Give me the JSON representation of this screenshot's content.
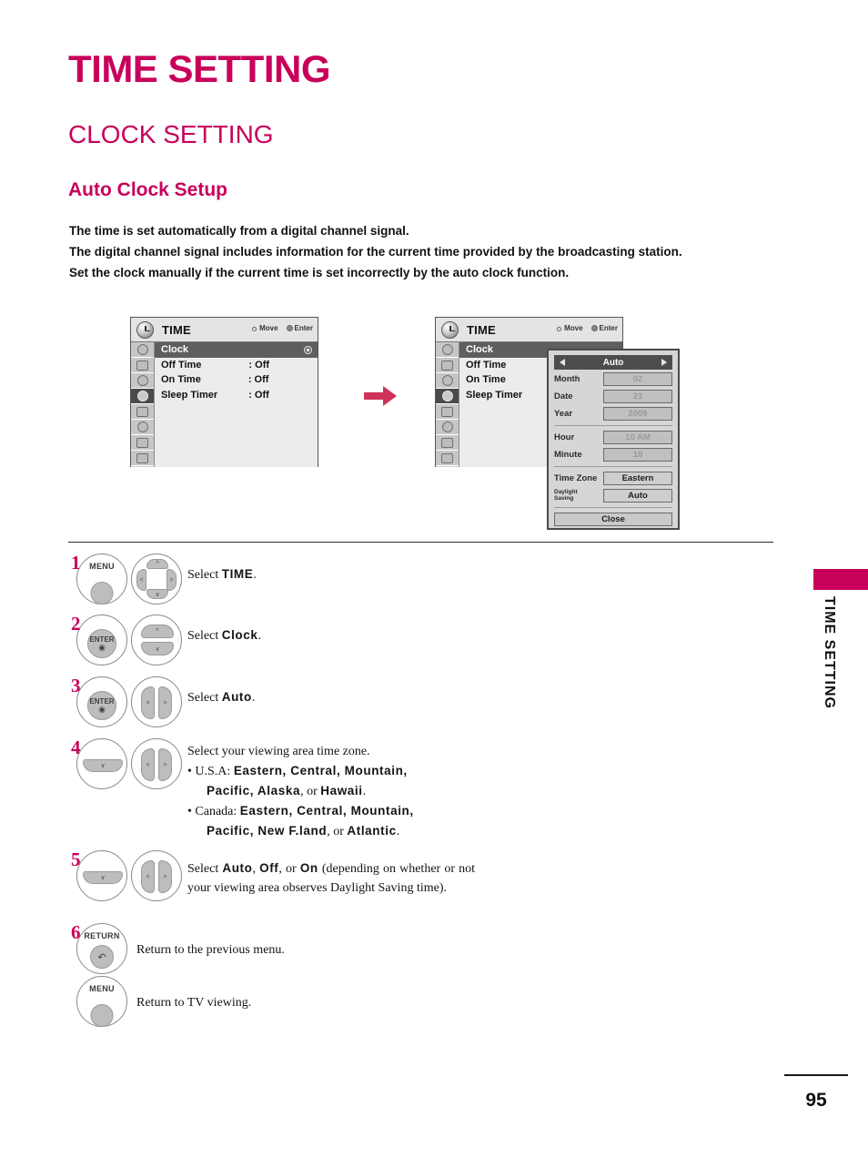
{
  "page": {
    "title": "TIME SETTING",
    "section": "CLOCK SETTING",
    "subsection": "Auto Clock Setup",
    "accent_color": "#c8005a",
    "number": "95",
    "side_label": "TIME SETTING"
  },
  "intro": {
    "line1": "The time is set automatically from a digital channel signal.",
    "line2": "The digital channel signal includes information for the current time provided by the broadcasting station.",
    "line3": "Set the clock manually if the current time is set incorrectly by the auto clock function."
  },
  "osd": {
    "title": "TIME",
    "hint_move": "Move",
    "hint_enter": "Enter",
    "rows": [
      {
        "label": "Clock",
        "value": ""
      },
      {
        "label": "Off Time",
        "value": ": Off"
      },
      {
        "label": "On Time",
        "value": ": Off"
      },
      {
        "label": "Sleep Timer",
        "value": ": Off"
      }
    ],
    "rail_icons": [
      "picture-icon",
      "screen-icon",
      "audio-icon",
      "time-icon",
      "option-icon",
      "lock-icon",
      "input-icon",
      "usb-icon"
    ]
  },
  "dialog": {
    "header": "Auto",
    "arrow_left": "left-arrow-icon",
    "arrow_right": "right-arrow-icon",
    "fields": [
      {
        "label": "Month",
        "value": "02",
        "dim": true
      },
      {
        "label": "Date",
        "value": "21",
        "dim": true
      },
      {
        "label": "Year",
        "value": "2009",
        "dim": true
      },
      {
        "label": "Hour",
        "value": "10 AM",
        "dim": true
      },
      {
        "label": "Minute",
        "value": "10",
        "dim": true
      }
    ],
    "time_zone_label": "Time Zone",
    "time_zone_value": "Eastern",
    "daylight_label_l1": "Daylight",
    "daylight_label_l2": "Saving",
    "daylight_value": "Auto",
    "close_label": "Close"
  },
  "steps": [
    {
      "num": "1",
      "buttons": [
        "MENU",
        "navpad-4way"
      ],
      "text_prefix": "Select ",
      "text_bold": "TIME",
      "text_suffix": "."
    },
    {
      "num": "2",
      "buttons": [
        "ENTER",
        "navpad-updown"
      ],
      "text_prefix": "Select ",
      "text_bold": "Clock",
      "text_suffix": "."
    },
    {
      "num": "3",
      "buttons": [
        "ENTER",
        "navpad-leftright"
      ],
      "text_prefix": "Select ",
      "text_bold": "Auto",
      "text_suffix": "."
    },
    {
      "num": "4",
      "buttons": [
        "navpad-down",
        "navpad-leftright"
      ],
      "heading": "Select your viewing area time zone.",
      "bullet_usa_prefix": "U.S.A:  ",
      "bullet_usa_zones": "Eastern,  Central,  Mountain,",
      "bullet_usa_zones2": "Pacific, Alaska",
      "bullet_usa_or": ", or ",
      "bullet_usa_last": "Hawaii",
      "bullet_usa_end": ".",
      "bullet_canada_prefix": "Canada:  ",
      "bullet_canada_zones": "Eastern,  Central,  Mountain,",
      "bullet_canada_zones2": "Pacific, New F.land",
      "bullet_canada_or": ", or ",
      "bullet_canada_last": "Atlantic",
      "bullet_canada_end": "."
    },
    {
      "num": "5",
      "buttons": [
        "navpad-down",
        "navpad-leftright"
      ],
      "t1": "Select ",
      "b1": "Auto",
      "t2": ", ",
      "b2": "Off",
      "t3": ", or ",
      "b3": "On",
      "t4": " (depending on whether or not your viewing area observes Daylight Saving time)."
    },
    {
      "num": "6",
      "buttons": [
        "RETURN",
        "MENU"
      ],
      "text_return": "Return to the previous menu.",
      "text_menu": "Return to TV viewing.",
      "return_label": "RETURN",
      "menu_label": "MENU"
    }
  ]
}
